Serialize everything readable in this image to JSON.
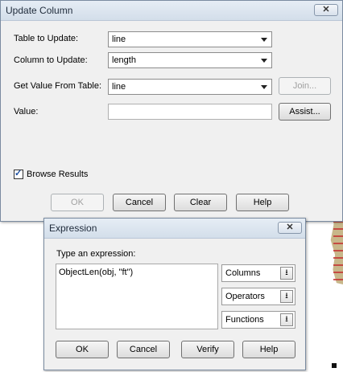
{
  "update_column": {
    "title": "Update Column",
    "close_label": "✕",
    "table_label": "Table to Update:",
    "table_value": "line",
    "column_label": "Column to Update:",
    "column_value": "length",
    "get_value_label": "Get Value From Table:",
    "get_value_value": "line",
    "join_label": "Join...",
    "value_label": "Value:",
    "value_text": "",
    "assist_label": "Assist...",
    "browse_results_label": "Browse Results",
    "browse_results_checked": true,
    "ok_label": "OK",
    "cancel_label": "Cancel",
    "clear_label": "Clear",
    "help_label": "Help"
  },
  "expression": {
    "title": "Expression",
    "close_label": "✕",
    "prompt_label": "Type an expression:",
    "expression_text": "ObjectLen(obj, \"ft\")",
    "columns_label": "Columns",
    "operators_label": "Operators",
    "functions_label": "Functions",
    "ok_label": "OK",
    "cancel_label": "Cancel",
    "verify_label": "Verify",
    "help_label": "Help"
  },
  "colors": {
    "dialog_bg": "#f0f0f0",
    "titlebar": "#d3deea",
    "check_mark": "#1b4ea0"
  }
}
